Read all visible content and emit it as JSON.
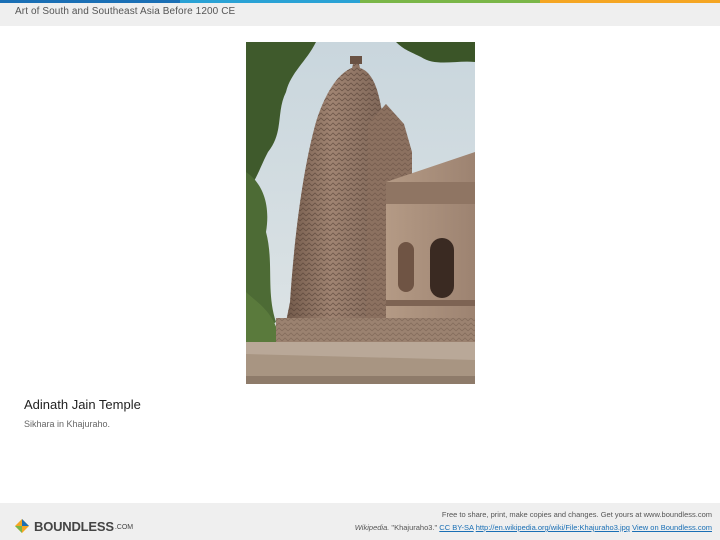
{
  "header": {
    "title": "Art of South and Southeast Asia Before 1200 CE",
    "accent_colors": [
      "#1a6fb5",
      "#2aa2d5",
      "#7ab648",
      "#f5a623"
    ]
  },
  "image": {
    "subject": "temple-photo"
  },
  "caption": {
    "title": "Adinath Jain Temple",
    "subtitle": "Sikhara in Khajuraho."
  },
  "footer": {
    "logo_text": "BOUNDLESS",
    "logo_suffix": ".COM",
    "line1": "Free to share, print, make copies and changes. Get yours at www.boundless.com",
    "source_name": "Wikipedia.",
    "source_title": "\"Khajuraho3.\"",
    "license": "CC BY-SA",
    "link_url": "http://en.wikipedia.org/wiki/File:Khajuraho3.jpg",
    "view_link": "View on Boundless.com"
  }
}
